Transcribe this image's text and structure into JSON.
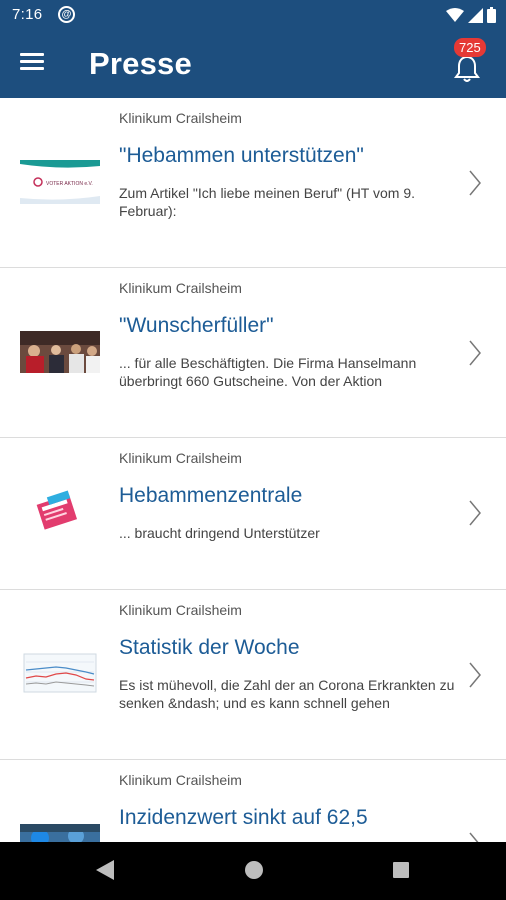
{
  "status_bar": {
    "time": "7:16",
    "at_glyph": "@"
  },
  "app_bar": {
    "title": "Presse",
    "notification_count": "725",
    "menu_icon": "hamburger-menu-icon",
    "bell_icon": "bell-icon"
  },
  "articles": [
    {
      "source": "Klinikum Crailsheim",
      "title": "\"Hebammen unterstützen\"",
      "snippet": "Zum Artikel \"Ich liebe meinen Beruf\" (HT vom 9. Februar):",
      "thumb_caption": "VOTER AKTION e.V."
    },
    {
      "source": "Klinikum Crailsheim",
      "title": "\"Wunscherfüller\"",
      "snippet": "... für alle Beschäftigten. Die Firma Hanselmann überbringt 660 Gutscheine. Von der Aktion"
    },
    {
      "source": "Klinikum Crailsheim",
      "title": "Hebammenzentrale",
      "snippet": "... braucht dringend Unterstützer"
    },
    {
      "source": "Klinikum Crailsheim",
      "title": "Statistik der Woche",
      "snippet": "Es ist mühevoll, die Zahl der an Corona Erkrankten zu senken &ndash; und es kann schnell gehen"
    },
    {
      "source": "Klinikum Crailsheim",
      "title": "Inzidenzwert sinkt auf 62,5",
      "snippet": ""
    }
  ],
  "colors": {
    "primary": "#1d4e7e",
    "title_blue": "#1d5c96",
    "badge_red": "#e53935"
  }
}
